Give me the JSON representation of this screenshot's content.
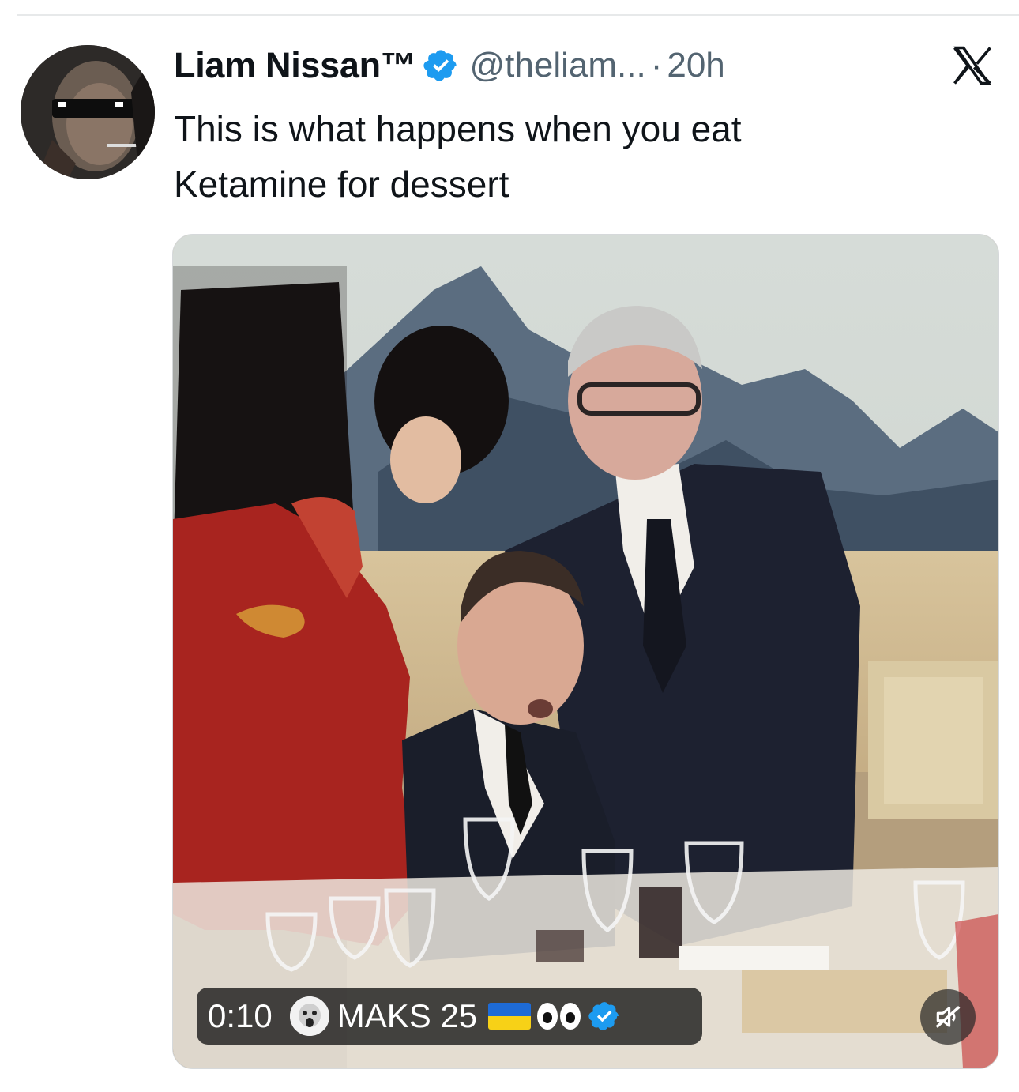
{
  "post": {
    "author": {
      "display_name": "Liam Nissan™",
      "handle": "@theliam...",
      "verified": true
    },
    "separator": "·",
    "time_ago": "20h",
    "text_lines": [
      "This is what happens when you eat",
      "Ketamine for dessert"
    ]
  },
  "media": {
    "type": "video",
    "elapsed": "0:10",
    "uploader": {
      "name": "MAKS 25",
      "verified": true,
      "name_emoji": [
        "ukraine-flag",
        "eyes"
      ]
    },
    "muted": true
  },
  "icons": {
    "brand": "x-logo-icon",
    "verified": "verified-badge-icon",
    "mute": "speaker-muted-icon"
  },
  "colors": {
    "text_primary": "#0f1419",
    "text_secondary": "#536471",
    "verified_blue": "#1d9bf0"
  }
}
